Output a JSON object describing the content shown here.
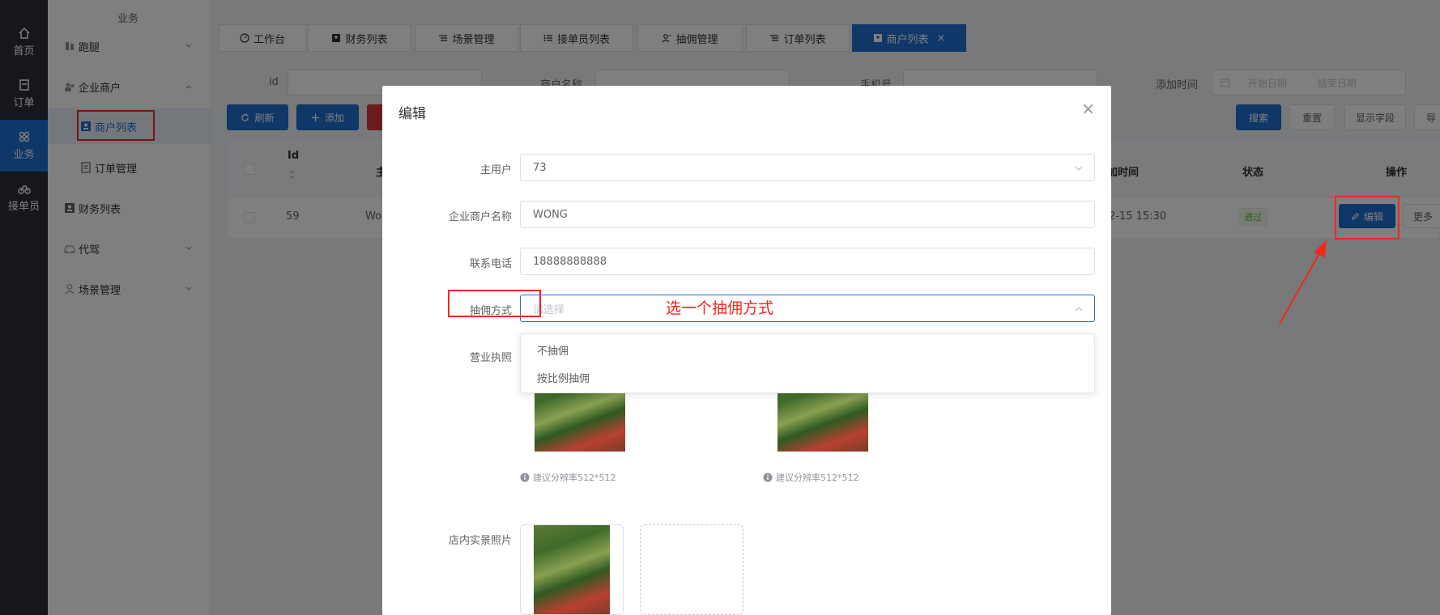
{
  "rail": {
    "items": [
      {
        "label": "首页",
        "icon": "home-icon"
      },
      {
        "label": "订单",
        "icon": "order-icon"
      },
      {
        "label": "业务",
        "icon": "business-icon",
        "active": true
      },
      {
        "label": "接单员",
        "icon": "bike-icon"
      }
    ]
  },
  "sidebar": {
    "header": "业务",
    "items": [
      {
        "label": "跑腿",
        "icon": "errand-icon",
        "expandable": true
      },
      {
        "label": "企业商户",
        "icon": "users-icon",
        "expandable": true
      },
      {
        "label": "商户列表",
        "icon": "id-card-icon",
        "active": true
      },
      {
        "label": "订单管理",
        "icon": "document-icon"
      },
      {
        "label": "财务列表",
        "icon": "id-card-icon"
      },
      {
        "label": "代驾",
        "icon": "car-icon",
        "expandable": true
      },
      {
        "label": "场景管理",
        "icon": "user-icon",
        "expandable": true
      }
    ]
  },
  "tabs": [
    {
      "label": "工作台",
      "icon": "dashboard-icon"
    },
    {
      "label": "财务列表",
      "icon": "id-card-icon"
    },
    {
      "label": "场景管理",
      "icon": "list-icon"
    },
    {
      "label": "接单员列表",
      "icon": "list-icon"
    },
    {
      "label": "抽佣管理",
      "icon": "user-icon"
    },
    {
      "label": "订单列表",
      "icon": "list-icon"
    },
    {
      "label": "商户列表",
      "icon": "id-card-icon",
      "active": true,
      "close": "×"
    }
  ],
  "search": {
    "id_label": "id",
    "name_label": "商户名称",
    "phone_label": "手机号",
    "time_label": "添加时间",
    "date_start_placeholder": "开始日期",
    "date_end_placeholder": "结束日期",
    "search_button": "搜索",
    "reset_button": "重置",
    "fields_button": "显示字段",
    "export_button": "导"
  },
  "toolbar": {
    "refresh": "刷新",
    "add": "添加"
  },
  "table": {
    "headers": {
      "id": "Id",
      "main": "主",
      "time": "加时间",
      "status": "状态",
      "action": "操作"
    },
    "row": {
      "id": "59",
      "name": "Wo",
      "time": "2-15 15:30",
      "status": "通过",
      "edit": "编辑",
      "more": "更多"
    }
  },
  "dialog": {
    "title": "编辑",
    "close": "×",
    "fields": {
      "main_user_label": "主用户",
      "main_user_value": "73",
      "company_label": "企业商户名称",
      "company_value": "WONG",
      "phone_label": "联系电话",
      "phone_value": "18888888888",
      "commission_label": "抽佣方式",
      "commission_placeholder": "请选择",
      "license_label": "营业执照",
      "photo_label": "店内实景照片"
    },
    "options": [
      "不抽佣",
      "按比例抽佣"
    ],
    "hint": "建议分辨率512*512"
  },
  "annotation": {
    "text": "选一个抽佣方式",
    "color": "#f0281e"
  },
  "colors": {
    "primary": "#1e6fd0",
    "rail_bg": "#2b2f3a",
    "success": "#67c23a"
  }
}
